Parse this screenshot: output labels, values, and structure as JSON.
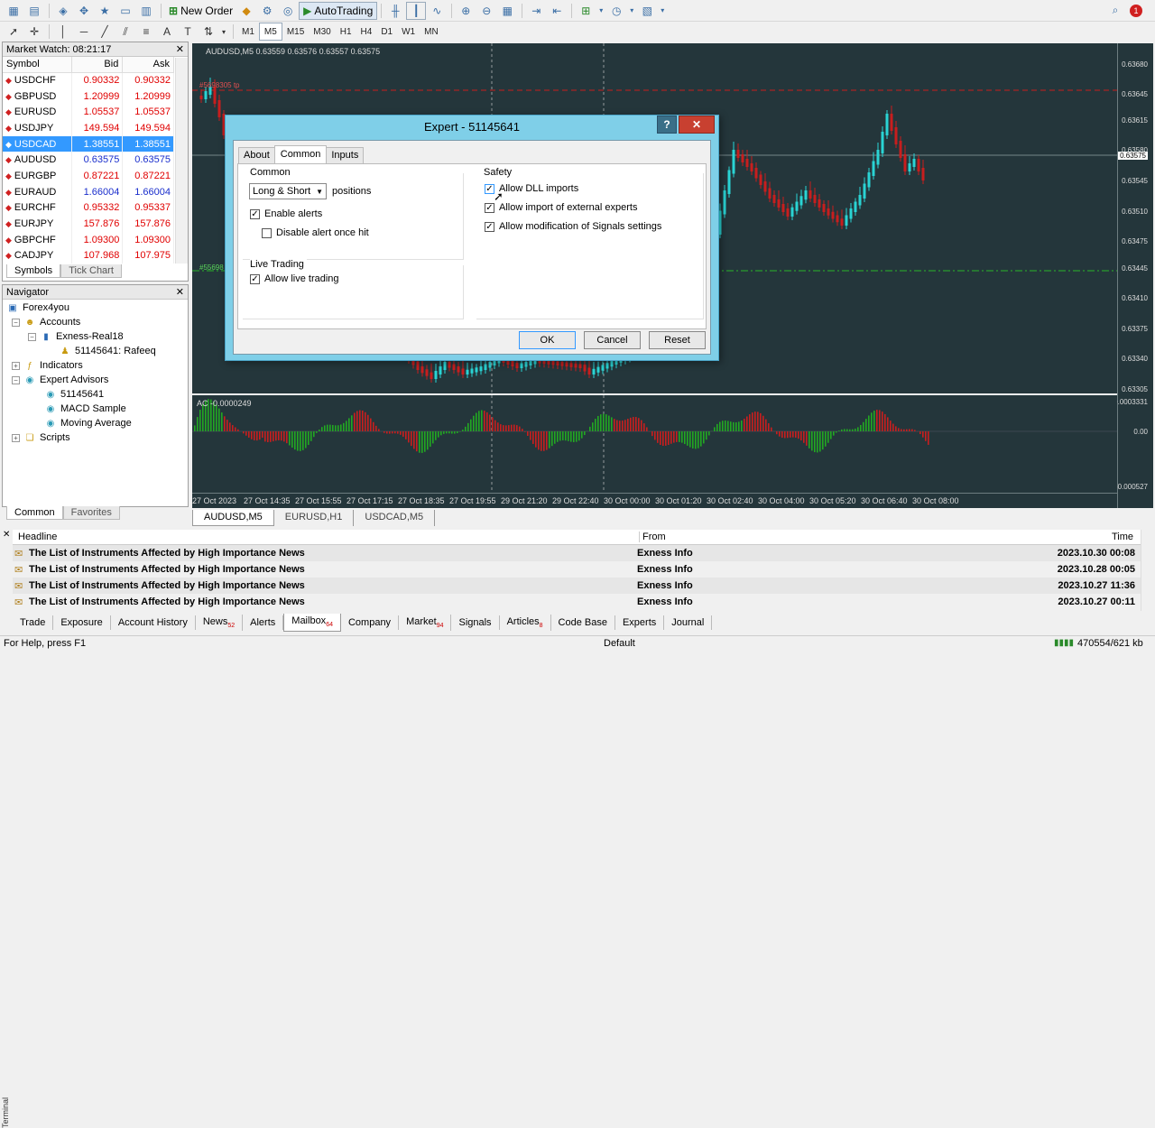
{
  "toolbar": {
    "new_order": "New Order",
    "autotrading": "AutoTrading",
    "timeframes": [
      "M1",
      "M5",
      "M15",
      "M30",
      "H1",
      "H4",
      "D1",
      "W1",
      "MN"
    ],
    "active_timeframe": "M5",
    "notif_count": "1"
  },
  "market_watch": {
    "title": "Market Watch: 08:21:17",
    "col_symbol": "Symbol",
    "col_bid": "Bid",
    "col_ask": "Ask",
    "rows": [
      {
        "symbol": "USDCHF",
        "bid": "0.90332",
        "ask": "0.90332",
        "dir": "up"
      },
      {
        "symbol": "GBPUSD",
        "bid": "1.20999",
        "ask": "1.20999",
        "dir": "up"
      },
      {
        "symbol": "EURUSD",
        "bid": "1.05537",
        "ask": "1.05537",
        "dir": "up"
      },
      {
        "symbol": "USDJPY",
        "bid": "149.594",
        "ask": "149.594",
        "dir": "up"
      },
      {
        "symbol": "USDCAD",
        "bid": "1.38551",
        "ask": "1.38551",
        "dir": "sel"
      },
      {
        "symbol": "AUDUSD",
        "bid": "0.63575",
        "ask": "0.63575",
        "dir": "dn"
      },
      {
        "symbol": "EURGBP",
        "bid": "0.87221",
        "ask": "0.87221",
        "dir": "up"
      },
      {
        "symbol": "EURAUD",
        "bid": "1.66004",
        "ask": "1.66004",
        "dir": "dn"
      },
      {
        "symbol": "EURCHF",
        "bid": "0.95332",
        "ask": "0.95337",
        "dir": "up"
      },
      {
        "symbol": "EURJPY",
        "bid": "157.876",
        "ask": "157.876",
        "dir": "up"
      },
      {
        "symbol": "GBPCHF",
        "bid": "1.09300",
        "ask": "1.09300",
        "dir": "up"
      },
      {
        "symbol": "CADJPY",
        "bid": "107.968",
        "ask": "107.975",
        "dir": "up"
      }
    ],
    "tabs": [
      "Symbols",
      "Tick Chart"
    ]
  },
  "navigator": {
    "title": "Navigator",
    "items": {
      "root": "Forex4you",
      "accounts": "Accounts",
      "server": "Exness-Real18",
      "account": "51145641: Rafeeq",
      "indicators": "Indicators",
      "experts": "Expert Advisors",
      "ea1": "51145641",
      "ea2": "MACD Sample",
      "ea3": "Moving Average",
      "scripts": "Scripts"
    },
    "tabs": [
      "Common",
      "Favorites"
    ]
  },
  "chart": {
    "title": "AUDUSD,M5  0.63559 0.63576 0.63557 0.63575",
    "order_label_1": "#5698305 tp",
    "order_label_2": "#55698",
    "sub_title": "AC -0.0000249",
    "prices": [
      "0.63680",
      "0.63645",
      "0.63615",
      "0.63580",
      "0.63575",
      "0.63545",
      "0.63510",
      "0.63475",
      "0.63445",
      "0.63410",
      "0.63375",
      "0.63340",
      "0.63305"
    ],
    "sub_scale": [
      "0.0003331",
      "0.00",
      "-0.000527"
    ],
    "times": [
      "27 Oct 2023",
      "27 Oct 14:35",
      "27 Oct 15:55",
      "27 Oct 17:15",
      "27 Oct 18:35",
      "27 Oct 19:55",
      "29 Oct 21:20",
      "29 Oct 22:40",
      "30 Oct 00:00",
      "30 Oct 01:20",
      "30 Oct 02:40",
      "30 Oct 04:00",
      "30 Oct 05:20",
      "30 Oct 06:40",
      "30 Oct 08:00"
    ],
    "tabs": [
      "AUDUSD,M5",
      "EURUSD,H1",
      "USDCAD,M5"
    ],
    "colors": {
      "bg": "#24363b",
      "bull": "#2ad4d4",
      "bear": "#c81e1e",
      "osc_up": "#22a822",
      "osc_dn": "#c81e1e"
    }
  },
  "dialog": {
    "title": "Expert - 51145641",
    "help": "?",
    "close": "✕",
    "tabs": [
      "About",
      "Common",
      "Inputs"
    ],
    "common_group": "Common",
    "positions_value": "Long & Short",
    "positions_label": "positions",
    "enable_alerts": "Enable alerts",
    "disable_alert_once": "Disable alert once hit",
    "live_group": "Live Trading",
    "allow_live": "Allow live trading",
    "safety_group": "Safety",
    "allow_dll": "Allow DLL imports",
    "allow_import": "Allow import of external experts",
    "allow_signals": "Allow modification of Signals settings",
    "ok": "OK",
    "cancel": "Cancel",
    "reset": "Reset"
  },
  "terminal": {
    "col_headline": "Headline",
    "col_from": "From",
    "col_time": "Time",
    "rows": [
      {
        "headline": "The List of Instruments Affected by High Importance News",
        "from": "Exness Info",
        "time": "2023.10.30 00:08"
      },
      {
        "headline": "The List of Instruments Affected by High Importance News",
        "from": "Exness Info",
        "time": "2023.10.28 00:05"
      },
      {
        "headline": "The List of Instruments Affected by High Importance News",
        "from": "Exness Info",
        "time": "2023.10.27 11:36"
      },
      {
        "headline": "The List of Instruments Affected by High Importance News",
        "from": "Exness Info",
        "time": "2023.10.27 00:11"
      }
    ],
    "tabs": [
      {
        "label": "Trade",
        "badge": ""
      },
      {
        "label": "Exposure",
        "badge": ""
      },
      {
        "label": "Account History",
        "badge": ""
      },
      {
        "label": "News",
        "badge": "52"
      },
      {
        "label": "Alerts",
        "badge": ""
      },
      {
        "label": "Mailbox",
        "badge": "64"
      },
      {
        "label": "Company",
        "badge": ""
      },
      {
        "label": "Market",
        "badge": "94"
      },
      {
        "label": "Signals",
        "badge": ""
      },
      {
        "label": "Articles",
        "badge": "8"
      },
      {
        "label": "Code Base",
        "badge": ""
      },
      {
        "label": "Experts",
        "badge": ""
      },
      {
        "label": "Journal",
        "badge": ""
      }
    ],
    "vertical_label": "Terminal"
  },
  "status": {
    "help": "For Help, press F1",
    "profile": "Default",
    "traffic": "470554/621 kb"
  }
}
